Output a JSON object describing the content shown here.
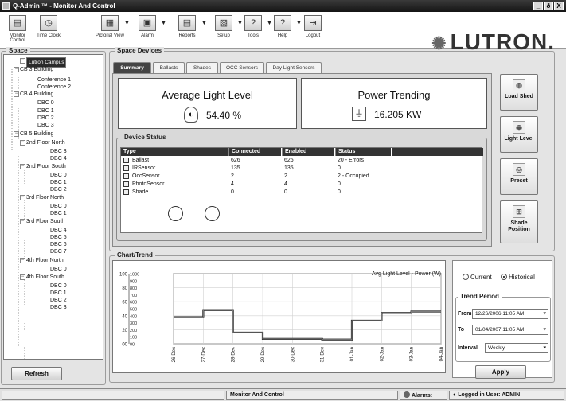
{
  "window": {
    "title": "Q-Admin ™   - Monitor And Control",
    "controls": [
      "_",
      "ð",
      "X"
    ]
  },
  "toolbar": {
    "items": [
      {
        "label": "Monitor Control",
        "icon": "monitor-control-icon",
        "glyph": "▤"
      },
      {
        "label": "Time Clock",
        "icon": "clock-icon",
        "glyph": "◷"
      },
      {
        "label": "Pictorial View",
        "icon": "pictorial-view-icon",
        "glyph": "▦"
      },
      {
        "label": "Alarm",
        "icon": "alarm-icon",
        "glyph": "▣"
      },
      {
        "label": "Reports",
        "icon": "reports-icon",
        "glyph": "▤"
      },
      {
        "label": "Setup",
        "icon": "setup-icon",
        "glyph": "▨"
      },
      {
        "label": "Tools",
        "icon": "tools-icon",
        "glyph": "?"
      },
      {
        "label": "Help",
        "icon": "help-icon",
        "glyph": "?"
      },
      {
        "label": "Logout",
        "icon": "logout-icon",
        "glyph": "⇥"
      }
    ]
  },
  "brand": {
    "logo_text": "LUTRON.",
    "burst_glyph": "✺"
  },
  "space": {
    "title": "Space",
    "tree": [
      {
        "label": "Lutron Campus",
        "selected": true
      },
      {
        "label": "CB 3 Building"
      },
      {
        "label": "Conference 1"
      },
      {
        "label": "Conference 2"
      },
      {
        "label": "CB 4 Building"
      },
      {
        "label": "DBC 0"
      },
      {
        "label": "DBC 1"
      },
      {
        "label": "DBC 2"
      },
      {
        "label": "DBC 3"
      },
      {
        "label": "CB 5 Building"
      },
      {
        "label": "2nd Floor North"
      },
      {
        "label": "DBC 3"
      },
      {
        "label": "DBC 4"
      },
      {
        "label": "2nd Floor South"
      },
      {
        "label": "DBC 0"
      },
      {
        "label": "DBC 1"
      },
      {
        "label": "DBC 2"
      },
      {
        "label": "3rd Floor North"
      },
      {
        "label": "DBC 0"
      },
      {
        "label": "DBC 1"
      },
      {
        "label": "3rd Floor South"
      },
      {
        "label": "DBC 4"
      },
      {
        "label": "DBC 5"
      },
      {
        "label": "DBC 6"
      },
      {
        "label": "DBC 7"
      },
      {
        "label": "4th Floor North"
      },
      {
        "label": "DBC 0"
      },
      {
        "label": "4th Floor South"
      },
      {
        "label": "DBC 0"
      },
      {
        "label": "DBC 1"
      },
      {
        "label": "DBC 2"
      },
      {
        "label": "DBC 3"
      }
    ],
    "refresh_label": "Refresh"
  },
  "devices": {
    "title": "Space Devices",
    "tabs": [
      "Summary",
      "Ballasts",
      "Shades",
      "OCC Sensors",
      "Day Light Sensors"
    ],
    "active_tab": "Summary",
    "avg_light": {
      "title": "Average Light Level",
      "value": "54.40 %",
      "icon": "bulb-icon",
      "glyph": "◐"
    },
    "power": {
      "title": "Power Trending",
      "value": "16.205 KW",
      "icon": "power-plug-icon",
      "glyph": "⏚"
    },
    "status_title": "Device Status",
    "columns": [
      "Type",
      "Connected",
      "Enabled",
      "Status"
    ],
    "rows": [
      [
        "Ballast",
        "626",
        "626",
        "20 - Errors"
      ],
      [
        "IRSensor",
        "135",
        "135",
        "0"
      ],
      [
        "OccSensor",
        "2",
        "2",
        "2 - Occupied"
      ],
      [
        "PhotoSensor",
        "4",
        "4",
        "0"
      ],
      [
        "Shade",
        "0",
        "0",
        "0"
      ]
    ]
  },
  "side_buttons": [
    {
      "label": "Load Shed",
      "icon": "load-shed-icon",
      "glyph": "◍"
    },
    {
      "label": "Light Level",
      "icon": "light-level-icon",
      "glyph": "◉"
    },
    {
      "label": "Preset",
      "icon": "preset-icon",
      "glyph": "◎"
    },
    {
      "label": "Shade Position",
      "icon": "shade-position-icon",
      "glyph": "⊞"
    }
  ],
  "chart_section": {
    "title": "Chart/Trend"
  },
  "chart_data": {
    "type": "line",
    "title": "",
    "x": [
      "26-Dec",
      "27-Dec",
      "28-Dec",
      "29-Dec",
      "30-Dec",
      "31-Dec",
      "01-Jan",
      "02-Jan",
      "03-Jan",
      "04-Jan"
    ],
    "series": [
      {
        "name": "Avg Light Level",
        "color": "#111111",
        "values": [
          38,
          48,
          16,
          7,
          7,
          6,
          33,
          44,
          46,
          46
        ]
      },
      {
        "name": "Power (W)",
        "color": "#999999",
        "values": [
          38,
          48,
          16,
          7,
          7,
          6,
          33,
          44,
          46,
          46
        ]
      }
    ],
    "left_axis": {
      "ticks": [
        "100",
        "80",
        "60",
        "40",
        "20",
        "00"
      ],
      "ylim": [
        0,
        100
      ]
    },
    "power_axis": {
      "ticks": [
        "1000",
        "900",
        "800",
        "700",
        "600",
        "500",
        "400",
        "300",
        "200",
        "100",
        "00"
      ],
      "ylim": [
        0,
        1000
      ]
    },
    "grid": true,
    "legend": "top-right",
    "legend_text": "—Avg Light Level  - Power (W)"
  },
  "trend": {
    "current_label": "Current",
    "historical_label": "Historical",
    "selected": "historical",
    "period_title": "Trend Period",
    "from_label": "From",
    "from_value": "12/26/2006 11:05 AM",
    "to_label": "To",
    "to_value": "01/04/2007 11:05 AM",
    "interval_label": "Interval",
    "interval_value": "Weekly",
    "apply_label": "Apply"
  },
  "status_bar": {
    "view": "Monitor And Control",
    "alarms": "Alarms:",
    "user": "Logged in User: ADMIN"
  }
}
